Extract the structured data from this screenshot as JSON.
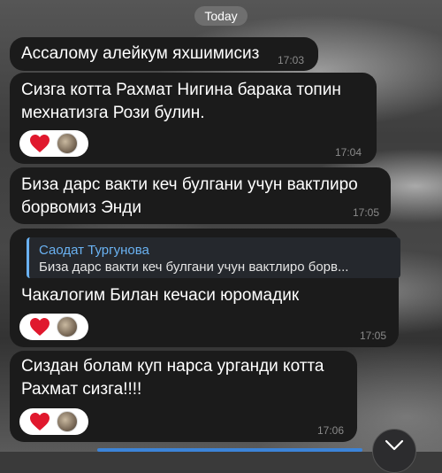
{
  "date_separator": "Today",
  "messages": [
    {
      "text": "Ассалому алейкум яхшимисиз",
      "time": "17:03"
    },
    {
      "line1": "Сизга котта Рахмат Нигина барака топин",
      "line2": "мехнатизга Рози булин.",
      "time": "17:04",
      "reactions": [
        "heart-icon",
        "avatar"
      ]
    },
    {
      "line1": "Биза дарс вакти кеч булгани учун вактлиро",
      "line2": "борвомиз Энди",
      "time": "17:05"
    },
    {
      "reply_author": "Саодат Тургунова",
      "reply_text": "Биза дарс вакти кеч булгани учун вактлиро борв...",
      "text": "Чакалогим Билан кечаси юромадик",
      "time": "17:05",
      "reactions": [
        "heart-icon",
        "avatar"
      ]
    },
    {
      "line1": "Сиздан болам куп нарса урганди котта",
      "line2": "Рахмат сизга!!!!",
      "time": "17:06",
      "reactions": [
        "heart-icon",
        "avatar"
      ]
    }
  ],
  "colors": {
    "bubble": "#1b1b1b",
    "reply_accent": "#6ab2f2",
    "reaction_heart": "#e0182d",
    "timestamp": "#8a8a8a"
  },
  "icons": {
    "scroll_down": "chevron-down-icon",
    "reaction": "heart-icon"
  }
}
